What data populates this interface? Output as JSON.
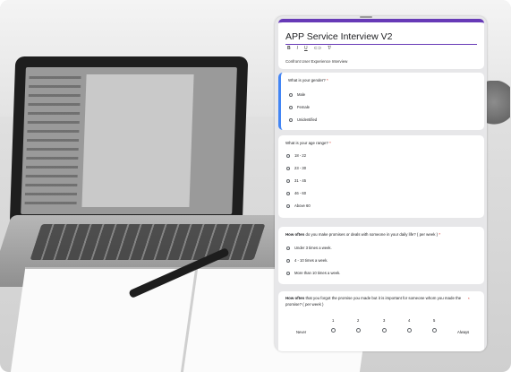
{
  "form": {
    "title": "APP Service Interview V2",
    "toolbar": {
      "bold": "B",
      "italic": "I",
      "underline": "U",
      "link": "⊂⊃",
      "clear": "T̸"
    },
    "description": "Confront User Experience Interview"
  },
  "questions": [
    {
      "title": "What is your gender?",
      "required": "*",
      "options": [
        "Male",
        "Female",
        "Unidentified"
      ]
    },
    {
      "title": "What is your age range?",
      "required": "*",
      "options": [
        "18 - 22",
        "23 - 30",
        "31 - 45",
        "46 - 60",
        "Above 60"
      ]
    },
    {
      "title_bold": "How often",
      "title_rest": " do you make promises or deals with someone in your daily life? ( per week )",
      "required": "*",
      "options": [
        "Under 3 times a week.",
        "4 - 10 times a week.",
        "More than 10 times a week."
      ]
    },
    {
      "title_bold": "How often",
      "title_rest": " that you forgot the promise you made but it is important for someone whom you made the promise? ( per week )",
      "required": "*",
      "scale": [
        "1",
        "2",
        "3",
        "4",
        "5"
      ],
      "low_label": "Never",
      "high_label": "Always"
    }
  ],
  "colors": {
    "accent": "#673ab7",
    "focus": "#4285f4",
    "required": "#d93025"
  }
}
